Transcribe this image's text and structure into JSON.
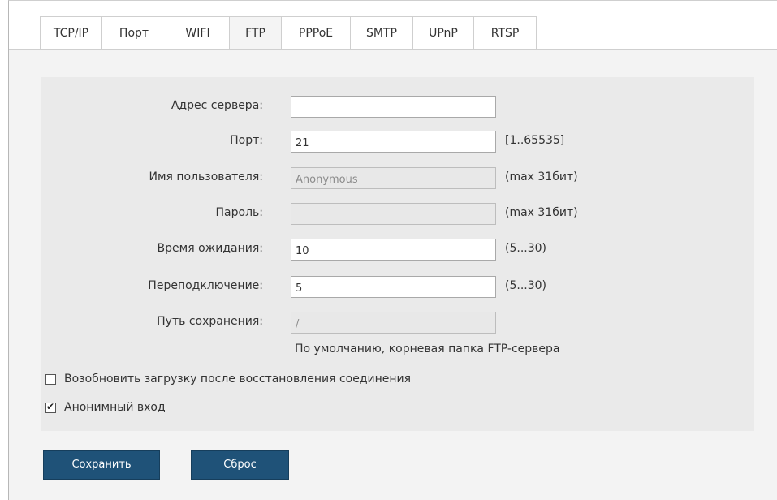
{
  "tabs": [
    {
      "label": "TCP/IP",
      "active": false
    },
    {
      "label": "Порт",
      "active": false
    },
    {
      "label": "WIFI",
      "active": false
    },
    {
      "label": "FTP",
      "active": true
    },
    {
      "label": "PPPoE",
      "active": false
    },
    {
      "label": "SMTP",
      "active": false
    },
    {
      "label": "UPnP",
      "active": false
    },
    {
      "label": "RTSP",
      "active": false
    }
  ],
  "form": {
    "server": {
      "label": "Адрес сервера:",
      "value": ""
    },
    "port": {
      "label": "Порт:",
      "value": "21",
      "hint": "[1..65535]"
    },
    "username": {
      "label": "Имя пользователя:",
      "value": "Anonymous",
      "hint": "(max 31бит)"
    },
    "password": {
      "label": "Пароль:",
      "value": "",
      "hint": "(max 31бит)"
    },
    "timeout": {
      "label": "Время ожидания:",
      "value": "10",
      "hint": "(5...30)"
    },
    "reconnect": {
      "label": "Переподключение:",
      "value": "5",
      "hint": "(5...30)"
    },
    "save_path": {
      "label": "Путь сохранения:",
      "value": "/",
      "note": "По умолчанию, корневая папка FTP-сервера"
    }
  },
  "options": {
    "resume": {
      "label": "Возобновить загрузку после восстановления соединения",
      "checked": false
    },
    "anonymous": {
      "label": "Анонимный вход",
      "checked": true,
      "mark": "✔"
    }
  },
  "buttons": {
    "save": "Сохранить",
    "reset": "Сброс"
  },
  "colors": {
    "button_bg": "#1f5278",
    "panel_bg": "#eaeaea",
    "content_bg": "#f3f3f3"
  }
}
